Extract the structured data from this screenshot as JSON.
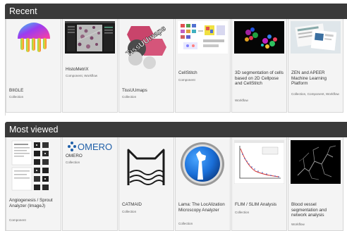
{
  "recent": {
    "title": "Recent",
    "cards": [
      {
        "name": "BIIGLE",
        "type": "Collection"
      },
      {
        "name": "HistoMetriX",
        "type": "Component, Workflow"
      },
      {
        "name": "TissUUmaps",
        "type": "Collection"
      },
      {
        "name": "CellStitch",
        "type": "Component"
      },
      {
        "name": "3D segmentation of cells based on 2D Cellpose and CellStitch",
        "type": "Workflow"
      },
      {
        "name": "ZEN and APEER Machine Learning Platform",
        "type": "Collection, Component, Workflow"
      }
    ]
  },
  "most_viewed": {
    "title": "Most viewed",
    "cards": [
      {
        "name": "Angiogenesis / Sprout Analyzer (ImageJ)",
        "type": "Component"
      },
      {
        "name": "OMERO",
        "type": "Collection"
      },
      {
        "name": "CATMAID",
        "type": "Collection"
      },
      {
        "name": "Lama: The LocAlization Microscopy Analyzer",
        "type": "Collection"
      },
      {
        "name": "FLIM / SLIM Analysis",
        "type": "Collection"
      },
      {
        "name": "Blood vessel segmentation and network analysis",
        "type": "Workflow"
      }
    ]
  },
  "logos": {
    "tissuumaps": "TissUUmaps",
    "omero": "OMERO"
  },
  "colors": {
    "header_bg": "#3a3a3a",
    "card_bg": "#f4f4f4",
    "omero_blue": "#1f5fa8"
  }
}
